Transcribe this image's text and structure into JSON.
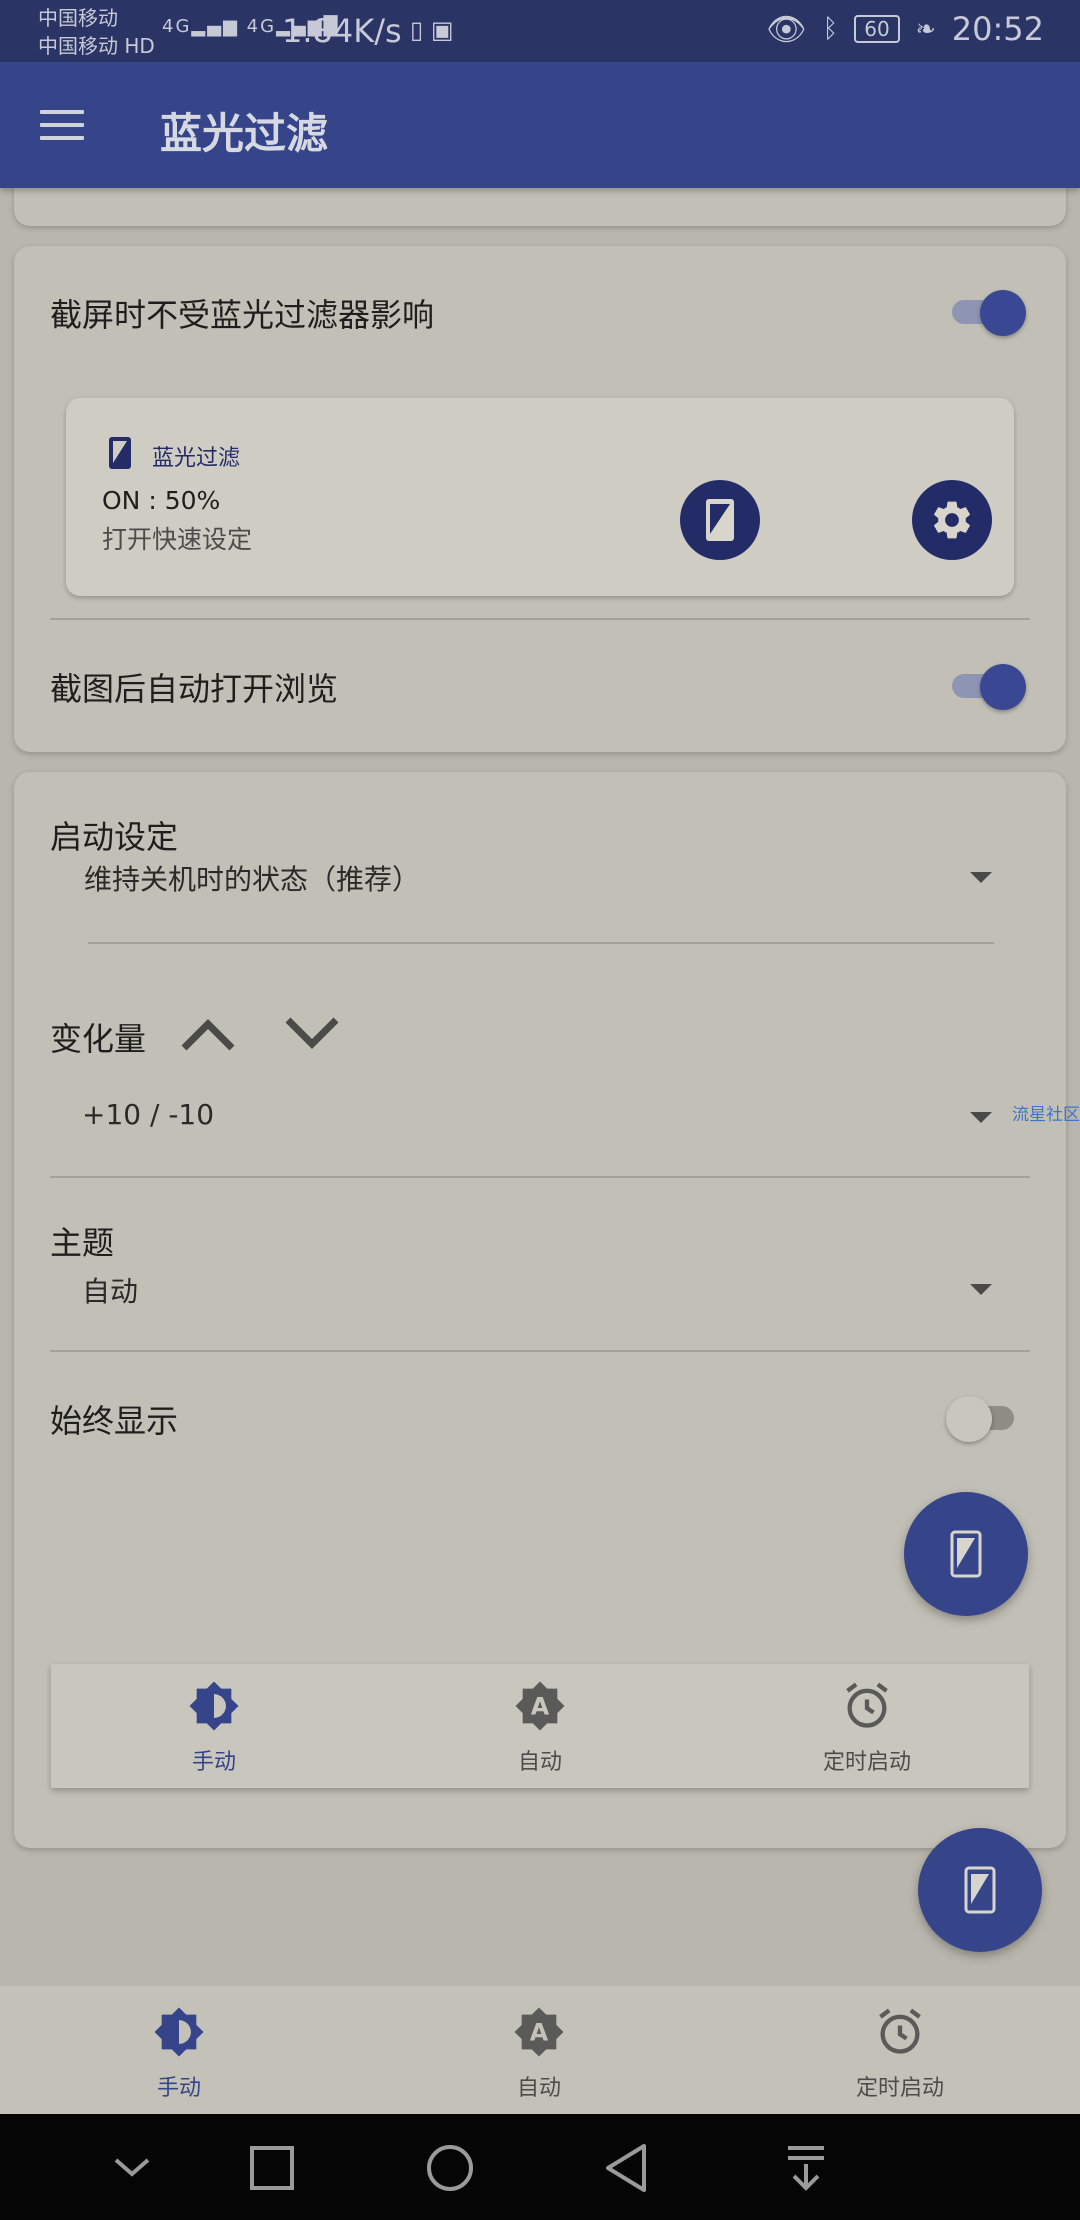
{
  "status_bar": {
    "carrier_1": "中国移动",
    "carrier_2": "中国移动 HD",
    "signal_1": "4G",
    "signal_2": "4G",
    "net_speed": "1.84K/s",
    "battery": "60",
    "time": "20:52"
  },
  "app_bar": {
    "title": "蓝光过滤"
  },
  "screenshot_card": {
    "screenshot_unaffected_label": "截屏时不受蓝光过滤器影响",
    "screenshot_unaffected_on": true,
    "notification": {
      "app_name": "蓝光过滤",
      "status": "ON : 50%",
      "subtitle": "打开快速设定"
    },
    "auto_open_label": "截图后自动打开浏览",
    "auto_open_on": true
  },
  "settings_card": {
    "startup": {
      "label": "启动设定",
      "value": "维持关机时的状态（推荐）"
    },
    "change": {
      "label": "变化量",
      "value": "+10 / -10"
    },
    "theme": {
      "label": "主题",
      "value": "自动"
    },
    "always_show": {
      "label": "始终显示",
      "on": false
    }
  },
  "inner_tabs": [
    {
      "label": "手动",
      "active": true
    },
    {
      "label": "自动",
      "active": false
    },
    {
      "label": "定时启动",
      "active": false
    }
  ],
  "bottom_tabs": [
    {
      "label": "手动",
      "active": true
    },
    {
      "label": "自动",
      "active": false
    },
    {
      "label": "定时启动",
      "active": false
    }
  ],
  "watermark": "流星社区",
  "colors": {
    "primary": "#36448a",
    "dark_primary": "#232c66",
    "background": "#b9b7ad"
  }
}
